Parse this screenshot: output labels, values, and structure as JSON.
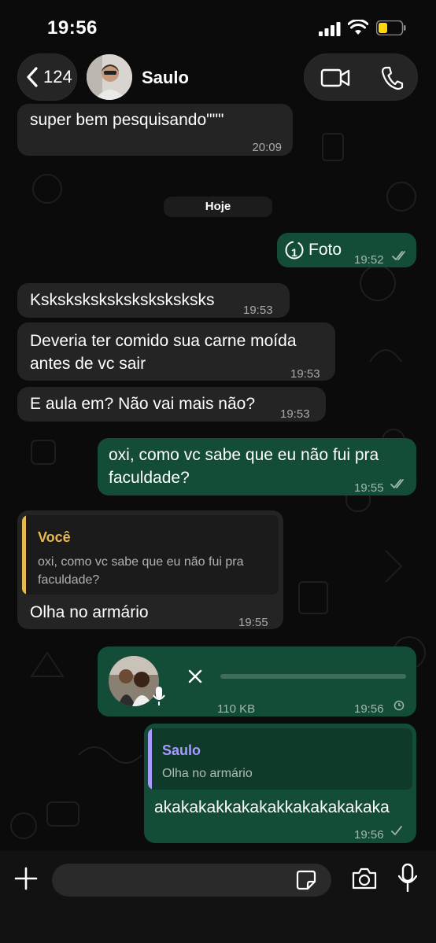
{
  "status_bar": {
    "time": "19:56"
  },
  "header": {
    "back_count": "124",
    "contact_name": "Saulo"
  },
  "messages": {
    "m0": {
      "text": "super bem pesquisando\"\"\"",
      "time": "20:09"
    },
    "date_separator": "Hoje",
    "m1": {
      "label": "Foto",
      "badge": "1",
      "time": "19:52"
    },
    "m2": {
      "text": "Ksksksksksksksksksksks",
      "time": "19:53"
    },
    "m3": {
      "line1": "Deveria ter comido sua carne moída",
      "line2": "antes de vc sair",
      "time": "19:53"
    },
    "m4": {
      "text": "E aula em? Não vai mais não?",
      "time": "19:53"
    },
    "m5": {
      "line1": "oxi, como vc sabe que eu não fui pra",
      "line2": "faculdade?",
      "time": "19:55"
    },
    "m6": {
      "reply_name": "Você",
      "reply_line1": "oxi, como vc sabe que eu não fui pra",
      "reply_line2": "faculdade?",
      "text": "Olha no armário",
      "time": "19:55"
    },
    "m7": {
      "size": "110 KB",
      "time": "19:56"
    },
    "m8": {
      "reply_name": "Saulo",
      "reply_text": "Olha no armário",
      "text": "akakakakkakakakkakakakakaka",
      "time": "19:56"
    }
  },
  "colors": {
    "incoming_bubble": "#242424",
    "outgoing_bubble": "#144d37",
    "reply_you_accent": "#e6b850",
    "reply_saulo_accent": "#a79bff"
  }
}
